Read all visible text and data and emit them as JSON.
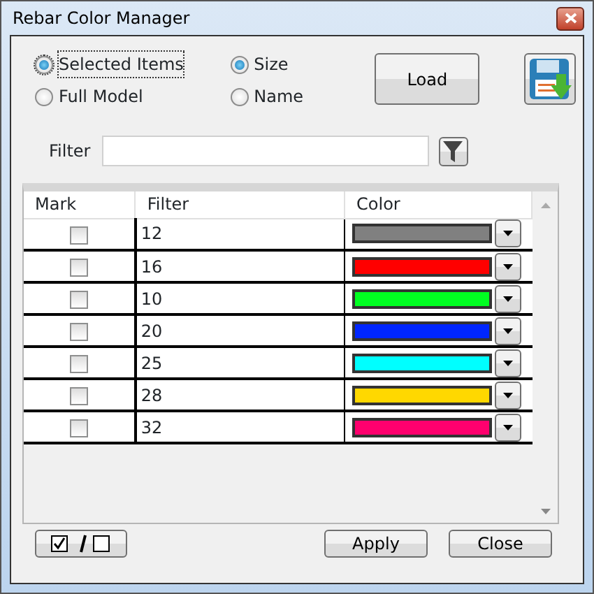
{
  "window": {
    "title": "Rebar Color Manager"
  },
  "scope_options": [
    {
      "label": "Selected Items",
      "selected": true
    },
    {
      "label": "Full Model",
      "selected": false
    }
  ],
  "group_options": [
    {
      "label": "Size",
      "selected": true
    },
    {
      "label": "Name",
      "selected": false
    }
  ],
  "load_button": "Load",
  "filter": {
    "label": "Filter"
  },
  "table": {
    "columns": [
      "Mark",
      "Filter",
      "Color"
    ],
    "rows": [
      {
        "checked": false,
        "filter": "12",
        "color": "#808080"
      },
      {
        "checked": false,
        "filter": "16",
        "color": "#ff0000"
      },
      {
        "checked": false,
        "filter": "10",
        "color": "#00ff21"
      },
      {
        "checked": false,
        "filter": "20",
        "color": "#0026ff"
      },
      {
        "checked": false,
        "filter": "25",
        "color": "#00ffff"
      },
      {
        "checked": false,
        "filter": "28",
        "color": "#ffd800"
      },
      {
        "checked": false,
        "filter": "32",
        "color": "#ff006e"
      }
    ]
  },
  "buttons": [
    "Apply",
    "Close"
  ]
}
